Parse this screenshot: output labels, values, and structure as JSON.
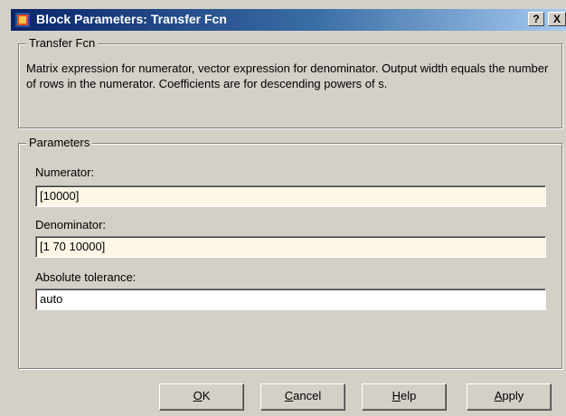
{
  "window": {
    "title": "Block Parameters: Transfer Fcn",
    "help_glyph": "?",
    "close_glyph": "X"
  },
  "block_group": {
    "legend": "Transfer Fcn",
    "description": "Matrix expression for numerator, vector expression for denominator.  Output width equals the number of rows in the numerator.  Coefficients are for descending powers of s."
  },
  "params_group": {
    "legend": "Parameters",
    "numerator_label": "Numerator:",
    "numerator_value": "[10000]",
    "denominator_label": "Denominator:",
    "denominator_value": "[1 70 10000]",
    "tolerance_label": "Absolute tolerance:",
    "tolerance_value": "auto"
  },
  "buttons": {
    "ok": {
      "mnemonic": "O",
      "rest": "K"
    },
    "cancel": {
      "mnemonic": "C",
      "rest": "ancel"
    },
    "help": {
      "mnemonic": "H",
      "rest": "elp"
    },
    "apply": {
      "mnemonic": "A",
      "rest": "pply"
    }
  }
}
